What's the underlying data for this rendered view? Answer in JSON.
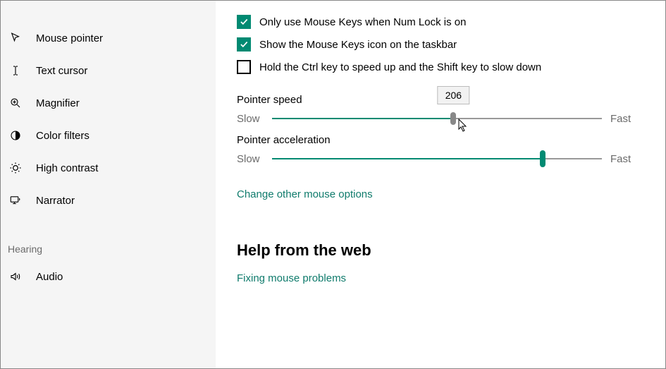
{
  "sidebar": {
    "items": [
      {
        "label": "Mouse pointer"
      },
      {
        "label": "Text cursor"
      },
      {
        "label": "Magnifier"
      },
      {
        "label": "Color filters"
      },
      {
        "label": "High contrast"
      },
      {
        "label": "Narrator"
      }
    ],
    "category": "Hearing",
    "audio_label": "Audio"
  },
  "checkboxes": {
    "numlock": {
      "label": "Only use Mouse Keys when Num Lock is on",
      "checked": true
    },
    "taskbar": {
      "label": "Show the Mouse Keys icon on the taskbar",
      "checked": true
    },
    "ctrlshift": {
      "label": "Hold the Ctrl key to speed up and the Shift key to slow down",
      "checked": false
    }
  },
  "sliders": {
    "pointer_speed": {
      "label": "Pointer speed",
      "min_label": "Slow",
      "max_label": "Fast",
      "value_pct": 55,
      "tooltip_value": "206"
    },
    "pointer_accel": {
      "label": "Pointer acceleration",
      "min_label": "Slow",
      "max_label": "Fast",
      "value_pct": 82
    }
  },
  "links": {
    "other_options": "Change other mouse options",
    "fixing": "Fixing mouse problems"
  },
  "help_heading": "Help from the web"
}
